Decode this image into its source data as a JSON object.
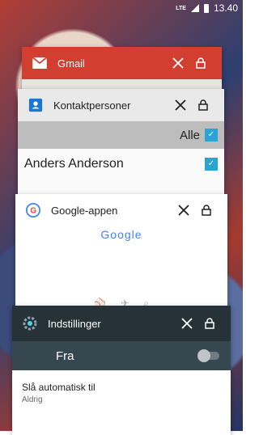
{
  "status_bar": {
    "network": "LTE",
    "time": "13.40"
  },
  "recents": [
    {
      "app": "Gmail",
      "icon": "gmail-icon"
    },
    {
      "app": "Kontaktpersoner",
      "icon": "contacts-icon",
      "content": {
        "filter_label": "Alle",
        "contact_name": "Anders Anderson"
      }
    },
    {
      "app": "Google-appen",
      "icon": "google-g-icon",
      "content": {
        "logo_text": "Google"
      }
    },
    {
      "app": "Indstillinger",
      "icon": "settings-icon",
      "content": {
        "toggle_label": "Fra",
        "pref_title": "Slå automatisk til",
        "pref_summary": "Aldrig"
      }
    }
  ],
  "colors": {
    "gmail_header": "#d23e2f",
    "settings_header": "#263238",
    "accent": "#2aa4d4"
  }
}
